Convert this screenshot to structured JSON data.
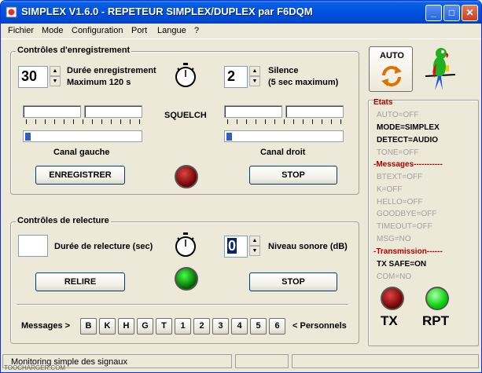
{
  "window": {
    "title": "SIMPLEX V1.6.0 - REPETEUR SIMPLEX/DUPLEX par F6DQM",
    "minimize_glyph": "_",
    "maximize_glyph": "□",
    "close_glyph": "✕"
  },
  "menu": [
    "Fichier",
    "Mode",
    "Configuration",
    "Port",
    "Langue",
    "?"
  ],
  "recording": {
    "group_title": "Contrôles d'enregistrement",
    "duration_value": "30",
    "duration_label": "Durée enregistrement",
    "duration_max": "Maximum 120 s",
    "silence_value": "2",
    "silence_label": "Silence",
    "silence_max": "(5 sec maximum)",
    "squelch_label": "SQUELCH",
    "left_channel_label": "Canal gauche",
    "right_channel_label": "Canal droit",
    "record_button": "ENREGISTRER",
    "stop_button": "STOP"
  },
  "playback": {
    "group_title": "Contrôles de relecture",
    "duration_value": "",
    "duration_label": "Durée de relecture (sec)",
    "volume_value": "0",
    "volume_label": "Niveau sonore (dB)",
    "play_button": "RELIRE",
    "stop_button": "STOP"
  },
  "messages": {
    "label": "Messages >",
    "buttons": [
      "B",
      "K",
      "H",
      "G",
      "T",
      "1",
      "2",
      "3",
      "4",
      "5",
      "6"
    ],
    "personal_label": "< Personnels"
  },
  "auto_button_label": "AUTO",
  "states": {
    "title": "Etats",
    "items": [
      {
        "text": "AUTO=OFF",
        "style": "grey"
      },
      {
        "text": "MODE=SIMPLEX",
        "style": "active"
      },
      {
        "text": "DETECT=AUDIO",
        "style": "active"
      },
      {
        "text": "TONE=OFF",
        "style": "grey"
      },
      {
        "text": "-Messages-----------",
        "style": "header"
      },
      {
        "text": "BTEXT=OFF",
        "style": "grey"
      },
      {
        "text": "K=OFF",
        "style": "grey"
      },
      {
        "text": "HELLO=OFF",
        "style": "grey"
      },
      {
        "text": "GOODBYE=OFF",
        "style": "grey"
      },
      {
        "text": "TIMEOUT=OFF",
        "style": "grey"
      },
      {
        "text": "MSG=NO",
        "style": "grey"
      },
      {
        "text": "-Transmission------",
        "style": "header"
      },
      {
        "text": "TX SAFE=ON",
        "style": "active"
      },
      {
        "text": "COM=NO",
        "style": "grey"
      }
    ],
    "tx_label": "TX",
    "rpt_label": "RPT"
  },
  "status": {
    "text": "Monitoring simple des signaux"
  },
  "watermark": "TOOCHARGER.COM",
  "colors": {
    "titlebar": "#0054e3",
    "led_red": "#6a0000",
    "led_green": "#00c000",
    "state_header": "#b00000",
    "state_inactive": "#a0a0a0"
  }
}
